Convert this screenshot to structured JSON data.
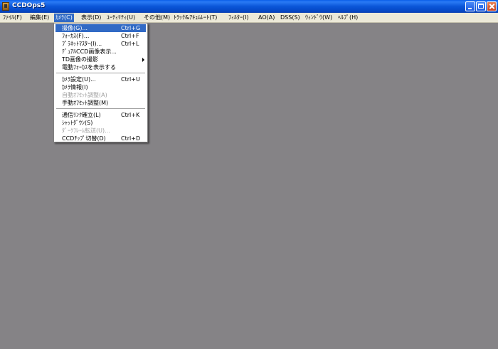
{
  "window": {
    "title": "CCDOps5"
  },
  "menubar": {
    "items": [
      {
        "label": "ﾌｧｲﾙ(F)"
      },
      {
        "label": "編集(E)"
      },
      {
        "label": "ｶﾒﾗ(C)"
      },
      {
        "label": "表示(D)"
      },
      {
        "label": "ﾕｰﾃｨﾘﾃｨ(U)"
      },
      {
        "label": "その他(M)"
      },
      {
        "label": "ﾄﾗｯｸ&ｱｷｭﾑﾚｰﾄ(T)"
      },
      {
        "label": "ﾌｨﾙﾀｰ(I)"
      },
      {
        "label": "AO(A)"
      },
      {
        "label": "DSS(S)"
      },
      {
        "label": "ｳｨﾝﾄﾞｳ(W)"
      },
      {
        "label": "ﾍﾙﾌﾟ(H)"
      }
    ]
  },
  "camera_menu": {
    "items": [
      {
        "label": "撮像(G)...",
        "shortcut": "Ctrl+G"
      },
      {
        "label": "ﾌｫｰｶｽ(F)...",
        "shortcut": "Ctrl+F"
      },
      {
        "label": "ﾌﾟﾗﾈｯﾄﾏｽﾀｰ(I)...",
        "shortcut": "Ctrl+L"
      },
      {
        "label": "ﾃﾞｭｱﾙCCD画像表示...",
        "shortcut": ""
      },
      {
        "label": "TD画像の撮影",
        "shortcut": ""
      },
      {
        "label": "電動ﾌｫｰｶｽを表示する",
        "shortcut": ""
      },
      {
        "label": "ｶﾒﾗ設定(U)...",
        "shortcut": "Ctrl+U"
      },
      {
        "label": "ｶﾒﾗ情報(I)",
        "shortcut": ""
      },
      {
        "label": "自動ｵﾌｾｯﾄ調整(A)",
        "shortcut": ""
      },
      {
        "label": "手動ｵﾌｾｯﾄ調整(M)",
        "shortcut": ""
      },
      {
        "label": "通信ﾘﾝｸ確立(L)",
        "shortcut": "Ctrl+K"
      },
      {
        "label": "ｼｬｯﾄﾀﾞｳﾝ(S)",
        "shortcut": ""
      },
      {
        "label": "ﾀﾞｰｸﾌﾚｰﾑ転送(U)...",
        "shortcut": ""
      },
      {
        "label": "CCDﾁｯﾌﾟ切替(D)",
        "shortcut": "Ctrl+D"
      }
    ]
  }
}
